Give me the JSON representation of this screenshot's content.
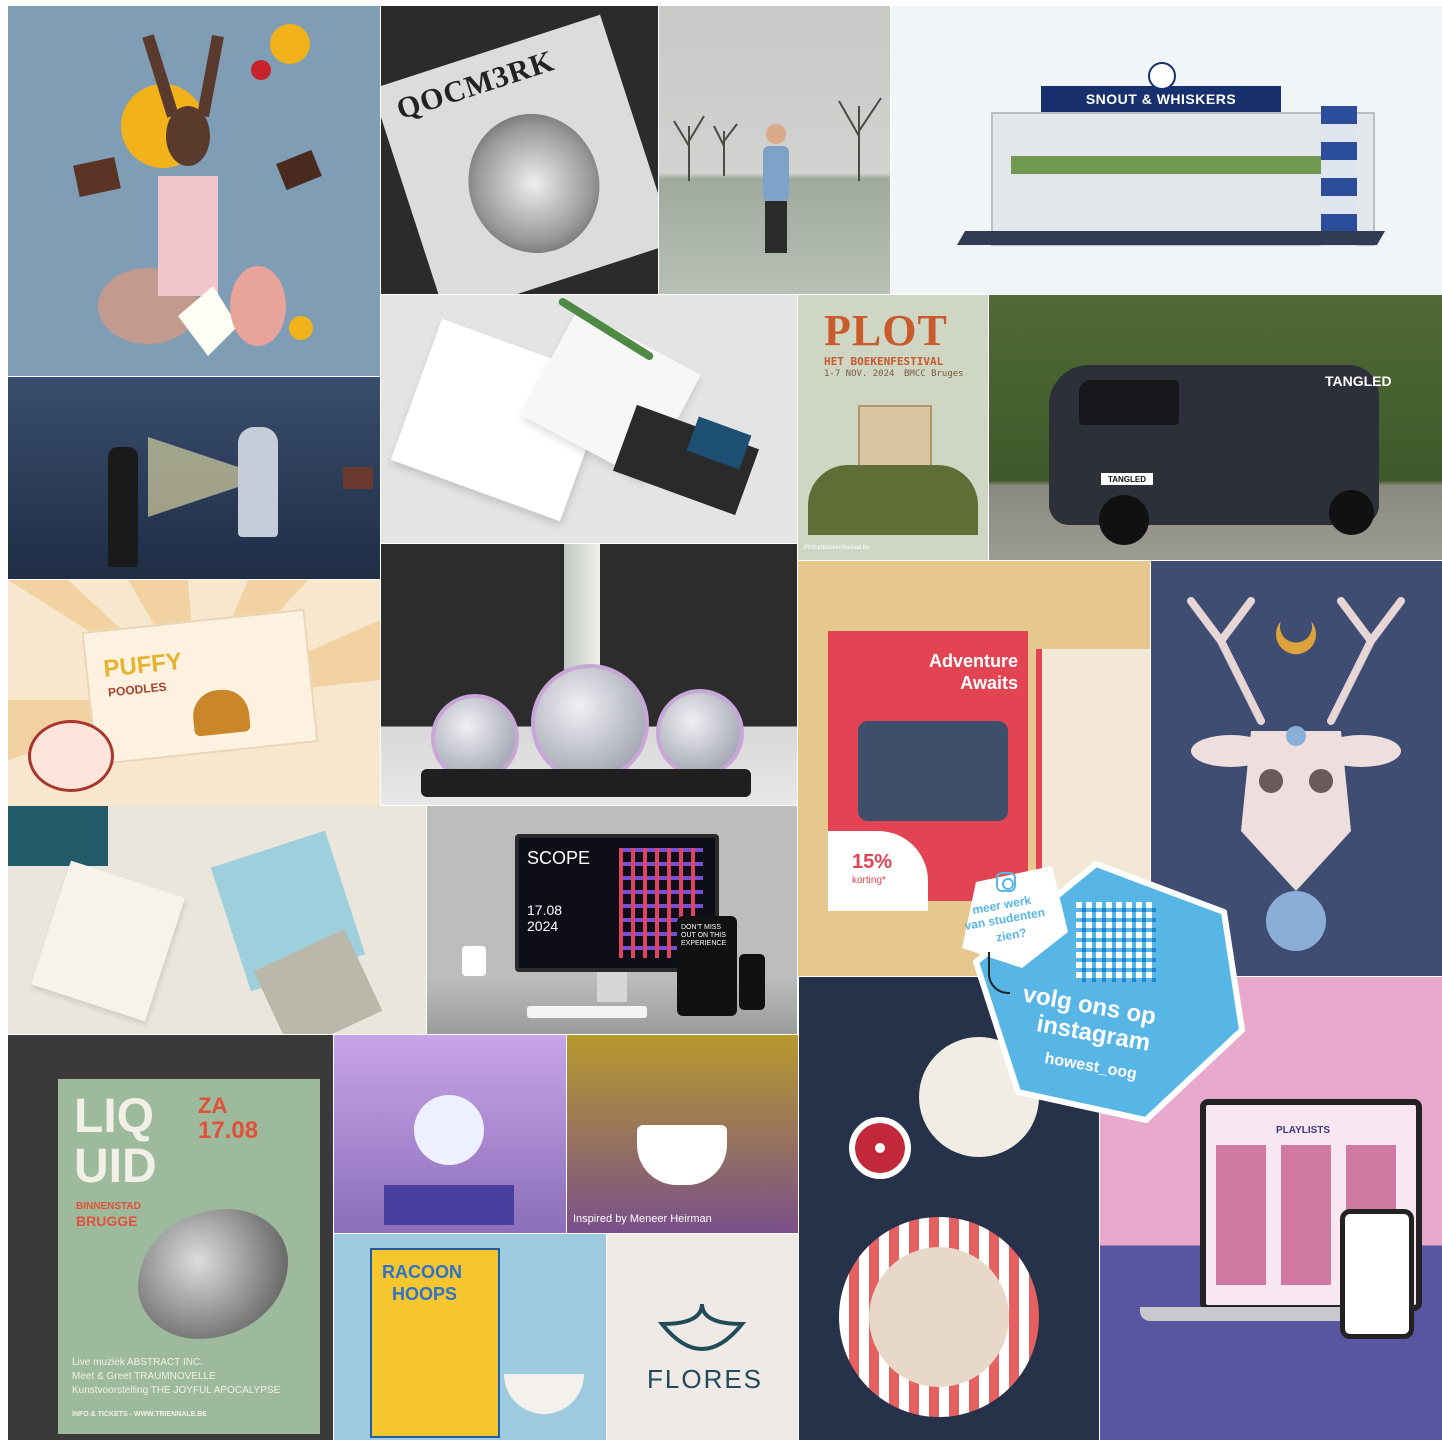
{
  "tiles": {
    "bokeh": {
      "brand_top": "QOCM3RK"
    },
    "snout": {
      "banner": "SNOUT & WHISKERS"
    },
    "plot": {
      "title": "PLOT",
      "subtitle": "HET BOEKENFESTIVAL",
      "dates": "1-7 NOV. 2024",
      "venue": "BMCC Bruges",
      "url": "Plothetboekenfestival.be"
    },
    "van": {
      "logo": "TANGLED",
      "plate": "TANGLED"
    },
    "puffy": {
      "brand_line1": "PUFFY",
      "brand_line2": "POODLES"
    },
    "adventure": {
      "headline": "Adventure Awaits",
      "discount": "15%",
      "discount_label": "korting*"
    },
    "scope": {
      "title": "SCOPE",
      "date": "17.08",
      "year": "2024",
      "tablet_text": "DON'T MISS OUT ON THIS EXPERIENCE"
    },
    "liquid": {
      "title_line1": "LIQ",
      "title_line2": "UID",
      "date_day": "ZA",
      "date": "17.08",
      "place1": "BINNENSTAD",
      "place2": "BRUGGE",
      "lineup1": "Live muziek ABSTRACT INC.",
      "lineup2": "Meet & Greet TRAUMNOVELLE",
      "lineup3": "Kunstvoorstelling THE JOYFUL APOCALYPSE",
      "footer": "INFO & TICKETS - WWW.TRIENNALE.BE"
    },
    "teacup": {
      "caption": "Inspired by Meneer Heirman"
    },
    "cereal": {
      "brand_line1": "RACOON",
      "brand_line2": "HOOPS"
    },
    "flores": {
      "brand": "FLORES"
    },
    "playlists": {
      "heading": "PLAYLISTS"
    }
  },
  "instagram_badge": {
    "prompt_line1": "meer werk",
    "prompt_line2": "van studenten",
    "prompt_line3": "zien?",
    "cta_line1": "volg ons op",
    "cta_line2": "instagram",
    "handle": "howest_oog",
    "icon": "instagram-icon"
  },
  "colors": {
    "badge_blue": "#58b6e6",
    "adventure_red": "#e34453",
    "deer_bg": "#3f4d73",
    "liquid_bg": "#9dbb9c"
  }
}
